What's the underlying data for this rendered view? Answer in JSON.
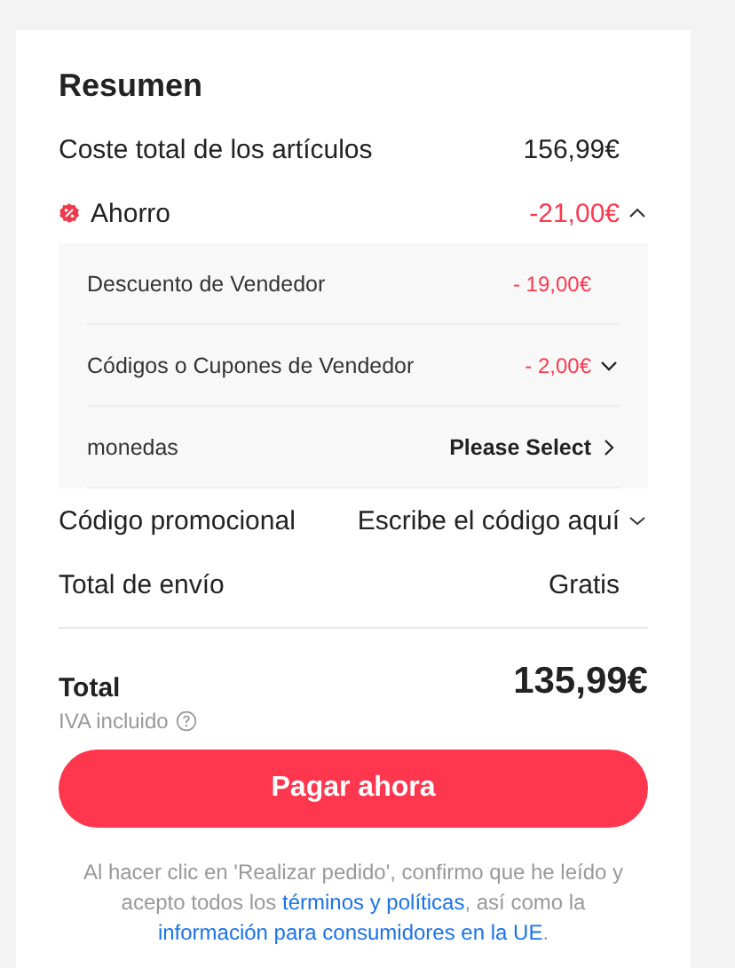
{
  "summary": {
    "title": "Resumen",
    "items_total": {
      "label": "Coste total de los artículos",
      "value": "156,99€"
    },
    "savings": {
      "label": "Ahorro",
      "value": "-21,00€",
      "expanded": true,
      "items": [
        {
          "kind": "amount",
          "label": "Descuento de Vendedor",
          "value": "- 19,00€"
        },
        {
          "kind": "expandable",
          "label": "Códigos o Cupones de Vendedor",
          "value": "- 2,00€",
          "expanded": false
        },
        {
          "kind": "select",
          "label": "monedas",
          "value": "Please Select"
        }
      ]
    },
    "promo": {
      "label": "Código promocional",
      "placeholder": "Escribe el código aquí",
      "expanded": false
    },
    "shipping": {
      "label": "Total de envío",
      "value": "Gratis"
    },
    "total": {
      "label": "Total",
      "value": "135,99€",
      "note": "IVA incluido"
    },
    "pay_button": "Pagar ahora",
    "disclaimer": [
      {
        "kind": "text",
        "text": "Al hacer clic en 'Realizar pedido', confirmo que he leído y acepto todos los "
      },
      {
        "kind": "link",
        "text": "términos y políticas"
      },
      {
        "kind": "text",
        "text": ", así como la "
      },
      {
        "kind": "link",
        "text": "información para consumidores en la UE"
      },
      {
        "kind": "text",
        "text": "."
      }
    ]
  }
}
